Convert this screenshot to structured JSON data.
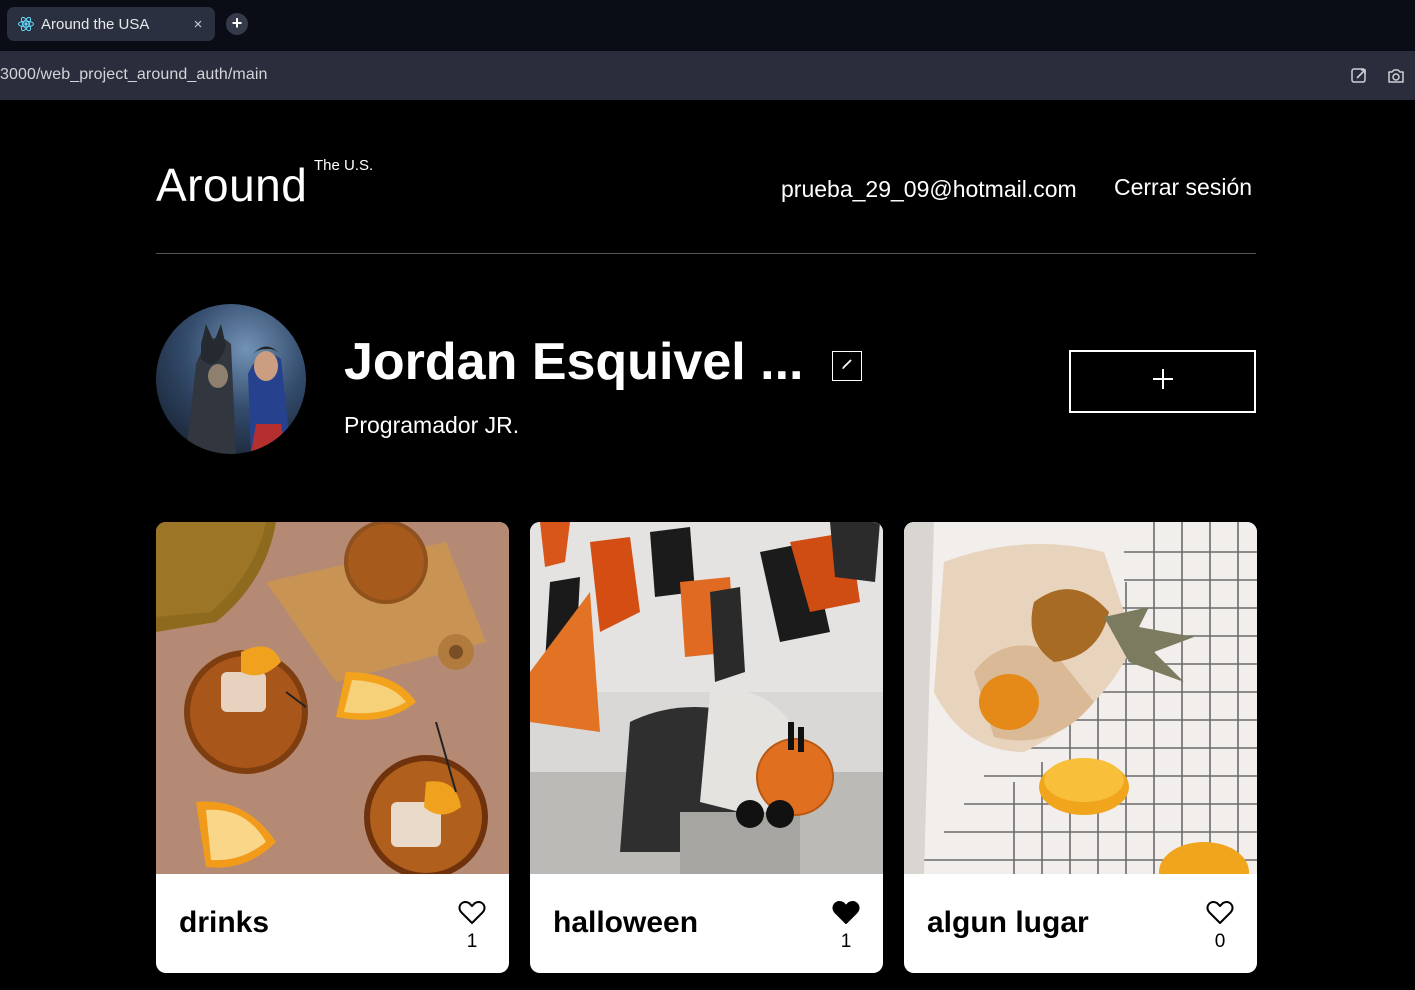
{
  "browser": {
    "tab_title": "Around the USA",
    "tab_close": "×",
    "new_tab": "+",
    "url": "3000/web_project_around_auth/main"
  },
  "header": {
    "logo": "Around",
    "logo_sup": "The U.S.",
    "email": "prueba_29_09@hotmail.com",
    "logout": "Cerrar sesión"
  },
  "profile": {
    "name": "Jordan Esquivel ...",
    "about": "Programador JR."
  },
  "cards": [
    {
      "title": "drinks",
      "likes": "1",
      "liked": false
    },
    {
      "title": "halloween",
      "likes": "1",
      "liked": true
    },
    {
      "title": "algun lugar",
      "likes": "0",
      "liked": false
    }
  ],
  "colors": {
    "background": "#000000",
    "card_background": "#ffffff",
    "tabbar": "#0a0c16",
    "urlbar": "#2a2d3c"
  }
}
